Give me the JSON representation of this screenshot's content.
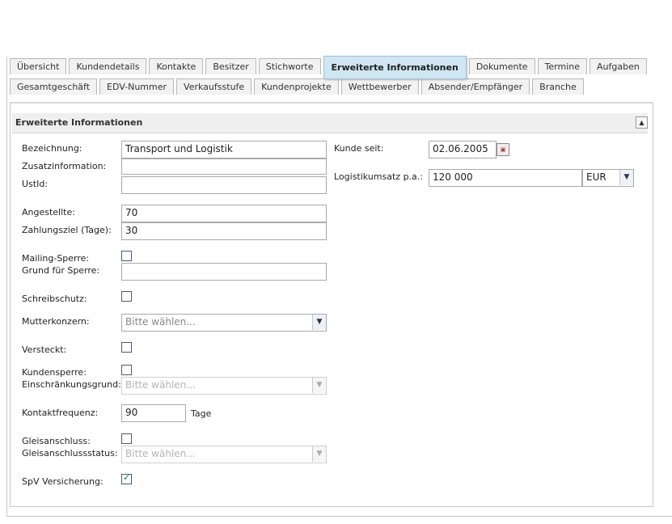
{
  "tabs_row1": [
    "Übersicht",
    "Kundendetails",
    "Kontakte",
    "Besitzer",
    "Stichworte",
    "Erweiterte Informationen",
    "Dokumente",
    "Termine",
    "Aufgaben"
  ],
  "tabs_row2": [
    "Gesamtgeschäft",
    "EDV-Nummer",
    "Verkaufsstufe",
    "Kundenprojekte",
    "Wettbewerber",
    "Absender/Empfänger",
    "Branche"
  ],
  "active_tab": "Erweiterte Informationen",
  "panel": {
    "title": "Erweiterte Informationen",
    "collapse_icon": "triangle-up-icon"
  },
  "form": {
    "bezeichnung_label": "Bezeichnung:",
    "bezeichnung_value": "Transport und Logistik",
    "zusatz_label": "Zusatzinformation:",
    "zusatz_value": "",
    "ustid_label": "UstId:",
    "ustid_value": "",
    "angestellte_label": "Angestellte:",
    "angestellte_value": "70",
    "zahlungsziel_label": "Zahlungsziel (Tage):",
    "zahlungsziel_value": "30",
    "mailing_label": "Mailing-Sperre:",
    "mailing_checked": false,
    "grund_label": "Grund für Sperre:",
    "grund_value": "",
    "schreibschutz_label": "Schreibschutz:",
    "schreibschutz_checked": false,
    "mutterkonzern_label": "Mutterkonzern:",
    "mutterkonzern_value": "Bitte wählen...",
    "versteckt_label": "Versteckt:",
    "versteckt_checked": false,
    "kundensperre_label": "Kundensperre:",
    "kundensperre_checked": false,
    "einschraenkung_label": "Einschränkungsgrund:",
    "einschraenkung_value": "Bitte wählen...",
    "kontaktfrequenz_label": "Kontaktfrequenz:",
    "kontaktfrequenz_value": "90",
    "kontaktfrequenz_unit": "Tage",
    "gleisanschluss_label": "Gleisanschluss:",
    "gleisanschluss_checked": false,
    "gleisstatus_label": "Gleisanschlussstatus:",
    "gleisstatus_value": "Bitte wählen...",
    "spv_label": "SpV Versicherung:",
    "spv_checked": true,
    "kunde_seit_label": "Kunde seit:",
    "kunde_seit_value": "02.06.2005",
    "logistik_label": "Logistikumsatz p.a.:",
    "logistik_value": "120 000",
    "currency_value": "EUR"
  },
  "icons": {
    "calendar": "calendar-icon",
    "dropdown": "chevron-down-icon",
    "checkbox_check": "checkmark-icon"
  },
  "colors": {
    "active_tab_bg": "#cfe6f3",
    "panel_header_bg": "#efefef",
    "checkbox_border": "#4a5a78",
    "checkmark": "#2a7a2a"
  }
}
